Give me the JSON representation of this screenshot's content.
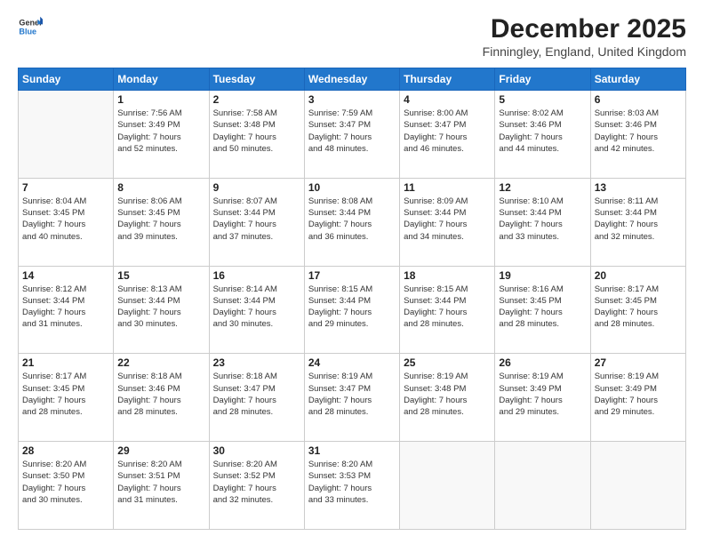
{
  "header": {
    "logo_general": "General",
    "logo_blue": "Blue",
    "month_title": "December 2025",
    "location": "Finningley, England, United Kingdom"
  },
  "weekdays": [
    "Sunday",
    "Monday",
    "Tuesday",
    "Wednesday",
    "Thursday",
    "Friday",
    "Saturday"
  ],
  "weeks": [
    [
      {
        "day": "",
        "info": ""
      },
      {
        "day": "1",
        "info": "Sunrise: 7:56 AM\nSunset: 3:49 PM\nDaylight: 7 hours\nand 52 minutes."
      },
      {
        "day": "2",
        "info": "Sunrise: 7:58 AM\nSunset: 3:48 PM\nDaylight: 7 hours\nand 50 minutes."
      },
      {
        "day": "3",
        "info": "Sunrise: 7:59 AM\nSunset: 3:47 PM\nDaylight: 7 hours\nand 48 minutes."
      },
      {
        "day": "4",
        "info": "Sunrise: 8:00 AM\nSunset: 3:47 PM\nDaylight: 7 hours\nand 46 minutes."
      },
      {
        "day": "5",
        "info": "Sunrise: 8:02 AM\nSunset: 3:46 PM\nDaylight: 7 hours\nand 44 minutes."
      },
      {
        "day": "6",
        "info": "Sunrise: 8:03 AM\nSunset: 3:46 PM\nDaylight: 7 hours\nand 42 minutes."
      }
    ],
    [
      {
        "day": "7",
        "info": "Sunrise: 8:04 AM\nSunset: 3:45 PM\nDaylight: 7 hours\nand 40 minutes."
      },
      {
        "day": "8",
        "info": "Sunrise: 8:06 AM\nSunset: 3:45 PM\nDaylight: 7 hours\nand 39 minutes."
      },
      {
        "day": "9",
        "info": "Sunrise: 8:07 AM\nSunset: 3:44 PM\nDaylight: 7 hours\nand 37 minutes."
      },
      {
        "day": "10",
        "info": "Sunrise: 8:08 AM\nSunset: 3:44 PM\nDaylight: 7 hours\nand 36 minutes."
      },
      {
        "day": "11",
        "info": "Sunrise: 8:09 AM\nSunset: 3:44 PM\nDaylight: 7 hours\nand 34 minutes."
      },
      {
        "day": "12",
        "info": "Sunrise: 8:10 AM\nSunset: 3:44 PM\nDaylight: 7 hours\nand 33 minutes."
      },
      {
        "day": "13",
        "info": "Sunrise: 8:11 AM\nSunset: 3:44 PM\nDaylight: 7 hours\nand 32 minutes."
      }
    ],
    [
      {
        "day": "14",
        "info": "Sunrise: 8:12 AM\nSunset: 3:44 PM\nDaylight: 7 hours\nand 31 minutes."
      },
      {
        "day": "15",
        "info": "Sunrise: 8:13 AM\nSunset: 3:44 PM\nDaylight: 7 hours\nand 30 minutes."
      },
      {
        "day": "16",
        "info": "Sunrise: 8:14 AM\nSunset: 3:44 PM\nDaylight: 7 hours\nand 30 minutes."
      },
      {
        "day": "17",
        "info": "Sunrise: 8:15 AM\nSunset: 3:44 PM\nDaylight: 7 hours\nand 29 minutes."
      },
      {
        "day": "18",
        "info": "Sunrise: 8:15 AM\nSunset: 3:44 PM\nDaylight: 7 hours\nand 28 minutes."
      },
      {
        "day": "19",
        "info": "Sunrise: 8:16 AM\nSunset: 3:45 PM\nDaylight: 7 hours\nand 28 minutes."
      },
      {
        "day": "20",
        "info": "Sunrise: 8:17 AM\nSunset: 3:45 PM\nDaylight: 7 hours\nand 28 minutes."
      }
    ],
    [
      {
        "day": "21",
        "info": "Sunrise: 8:17 AM\nSunset: 3:45 PM\nDaylight: 7 hours\nand 28 minutes."
      },
      {
        "day": "22",
        "info": "Sunrise: 8:18 AM\nSunset: 3:46 PM\nDaylight: 7 hours\nand 28 minutes."
      },
      {
        "day": "23",
        "info": "Sunrise: 8:18 AM\nSunset: 3:47 PM\nDaylight: 7 hours\nand 28 minutes."
      },
      {
        "day": "24",
        "info": "Sunrise: 8:19 AM\nSunset: 3:47 PM\nDaylight: 7 hours\nand 28 minutes."
      },
      {
        "day": "25",
        "info": "Sunrise: 8:19 AM\nSunset: 3:48 PM\nDaylight: 7 hours\nand 28 minutes."
      },
      {
        "day": "26",
        "info": "Sunrise: 8:19 AM\nSunset: 3:49 PM\nDaylight: 7 hours\nand 29 minutes."
      },
      {
        "day": "27",
        "info": "Sunrise: 8:19 AM\nSunset: 3:49 PM\nDaylight: 7 hours\nand 29 minutes."
      }
    ],
    [
      {
        "day": "28",
        "info": "Sunrise: 8:20 AM\nSunset: 3:50 PM\nDaylight: 7 hours\nand 30 minutes."
      },
      {
        "day": "29",
        "info": "Sunrise: 8:20 AM\nSunset: 3:51 PM\nDaylight: 7 hours\nand 31 minutes."
      },
      {
        "day": "30",
        "info": "Sunrise: 8:20 AM\nSunset: 3:52 PM\nDaylight: 7 hours\nand 32 minutes."
      },
      {
        "day": "31",
        "info": "Sunrise: 8:20 AM\nSunset: 3:53 PM\nDaylight: 7 hours\nand 33 minutes."
      },
      {
        "day": "",
        "info": ""
      },
      {
        "day": "",
        "info": ""
      },
      {
        "day": "",
        "info": ""
      }
    ]
  ]
}
